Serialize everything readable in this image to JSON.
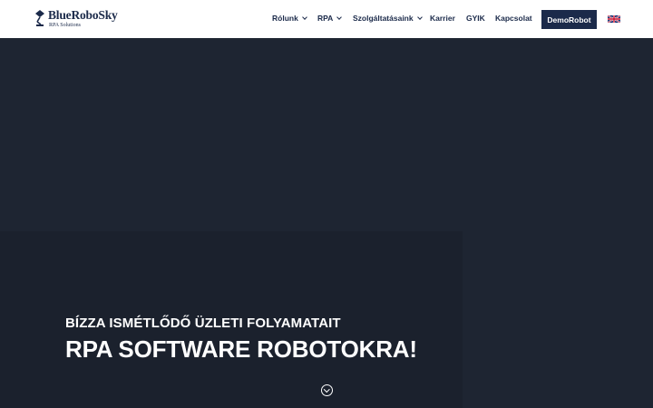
{
  "brand": {
    "name": "BlueRoboSky",
    "tagline": "RPA Solutions",
    "color": "#1b2a4a"
  },
  "nav": {
    "items": [
      {
        "label": "Rólunk",
        "has_dropdown": true
      },
      {
        "label": "RPA",
        "has_dropdown": true
      },
      {
        "label": "Szolgáltatásaink",
        "has_dropdown": true
      },
      {
        "label": "Karrier",
        "has_dropdown": false
      },
      {
        "label": "GYIK",
        "has_dropdown": false
      },
      {
        "label": "Kapcsolat",
        "has_dropdown": false
      }
    ],
    "cta_label": "DemoRobot",
    "language_icon": "uk-flag-icon"
  },
  "hero": {
    "subtitle": "BÍZZA ISMÉTLŐDŐ ÜZLETI FOLYAMATAIT",
    "title": "RPA SOFTWARE ROBOTOKRA!",
    "background_color": "#1e2532",
    "scroll_icon": "chevron-down-circle-icon"
  }
}
